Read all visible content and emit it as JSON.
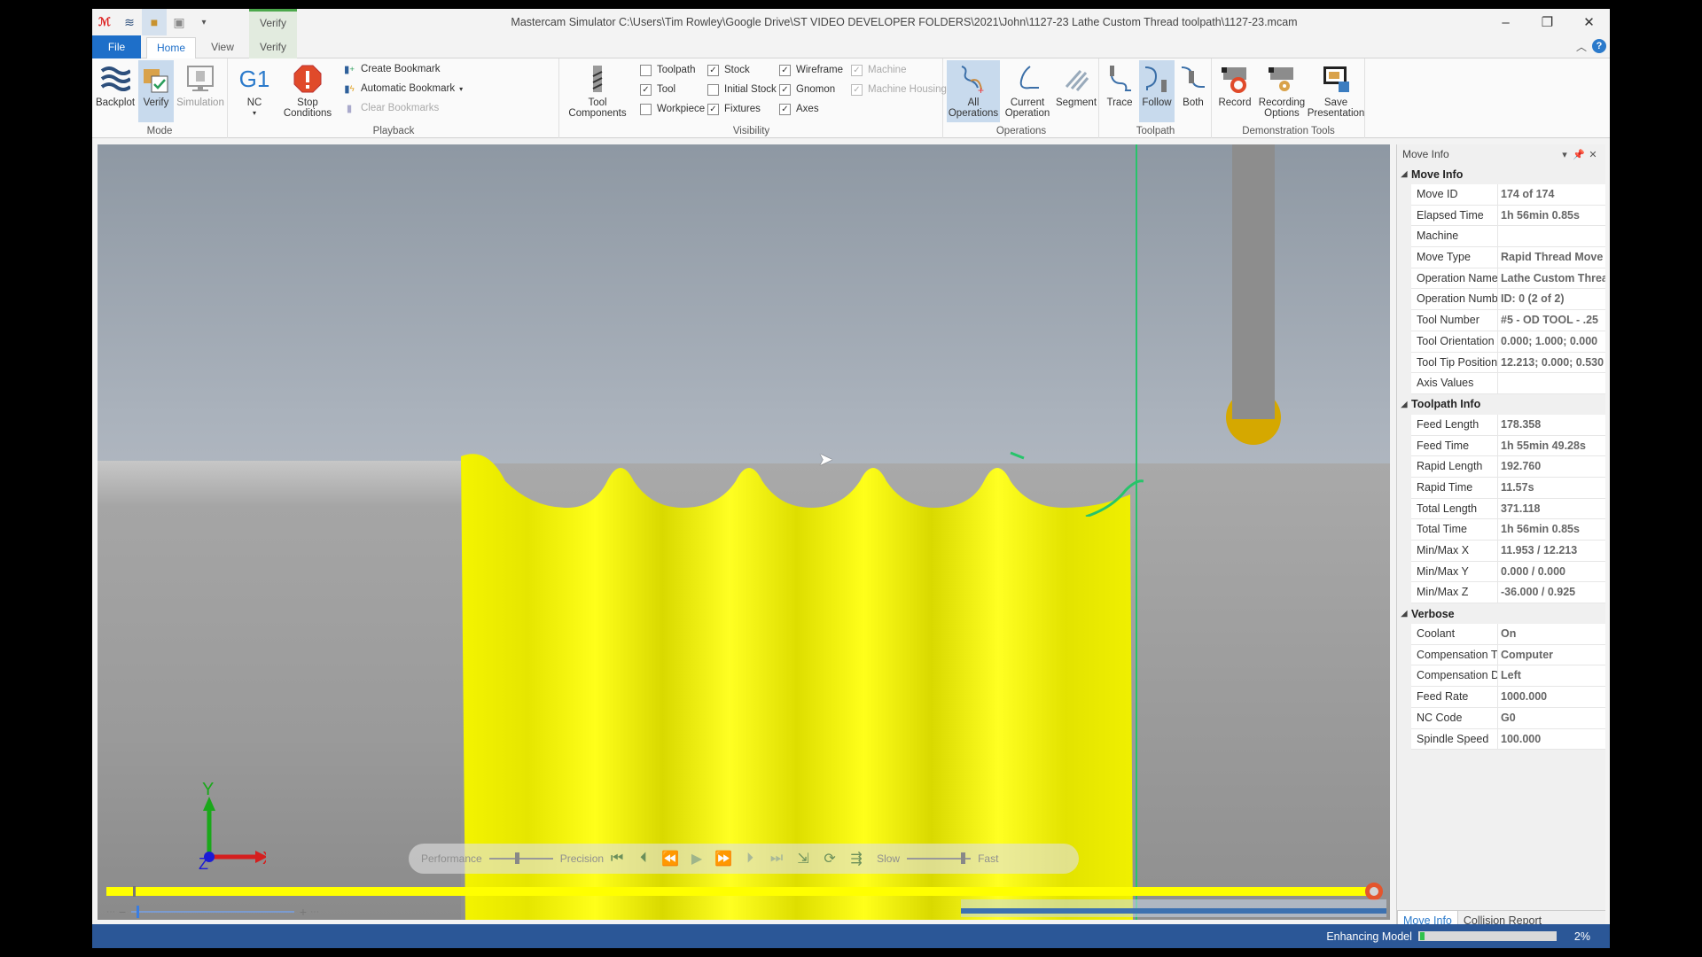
{
  "window": {
    "title": "Mastercam Simulator  C:\\Users\\Tim Rowley\\Google Drive\\ST VIDEO DEVELOPER FOLDERS\\2021\\John\\1127-23 Lathe Custom Thread toolpath\\1127-23.mcam",
    "context_tab": "Verify",
    "controls": {
      "minimize": "–",
      "restore": "❐",
      "close": "✕"
    }
  },
  "tabs": {
    "file": "File",
    "home": "Home",
    "view": "View",
    "verify": "Verify"
  },
  "ribbon": {
    "mode": {
      "label": "Mode",
      "backplot": "Backplot",
      "verify": "Verify",
      "simulation": "Simulation"
    },
    "playback": {
      "label": "Playback",
      "nc_icon": "G1",
      "nc": "NC",
      "stop_conditions": "Stop Conditions",
      "create_bookmark": "Create Bookmark",
      "automatic_bookmark": "Automatic Bookmark",
      "clear_bookmarks": "Clear Bookmarks"
    },
    "visibility": {
      "label": "Visibility",
      "tool_components": "Tool Components",
      "checks": [
        {
          "label": "Toolpath",
          "checked": false,
          "enabled": true
        },
        {
          "label": "Tool",
          "checked": true,
          "enabled": true
        },
        {
          "label": "Workpiece",
          "checked": false,
          "enabled": true
        },
        {
          "label": "Stock",
          "checked": true,
          "enabled": true
        },
        {
          "label": "Initial Stock",
          "checked": false,
          "enabled": true
        },
        {
          "label": "Fixtures",
          "checked": true,
          "enabled": true
        },
        {
          "label": "Wireframe",
          "checked": true,
          "enabled": true
        },
        {
          "label": "Gnomon",
          "checked": true,
          "enabled": true
        },
        {
          "label": "Axes",
          "checked": true,
          "enabled": true
        },
        {
          "label": "Machine",
          "checked": true,
          "enabled": false
        },
        {
          "label": "Machine Housing",
          "checked": true,
          "enabled": false
        }
      ]
    },
    "operations": {
      "label": "Operations",
      "all": "All Operations",
      "current": "Current Operation",
      "segment": "Segment"
    },
    "toolpath": {
      "label": "Toolpath",
      "trace": "Trace",
      "follow": "Follow",
      "both": "Both"
    },
    "demo": {
      "label": "Demonstration Tools",
      "record": "Record",
      "recording_options": "Recording Options",
      "save_presentation": "Save Presentation"
    }
  },
  "viewport": {
    "gnomon": {
      "x": "X",
      "y": "Y",
      "z": "Z"
    },
    "playbar": {
      "performance": "Performance",
      "precision": "Precision",
      "slow": "Slow",
      "fast": "Fast",
      "quality_position": 0.4,
      "speed_position": 0.85
    },
    "timeline_progress": 1.0
  },
  "panel": {
    "title": "Move Info",
    "sections": [
      {
        "name": "Move Info",
        "rows": [
          {
            "k": "Move ID",
            "v": "174 of 174"
          },
          {
            "k": "Elapsed Time",
            "v": "1h 56min 0.85s"
          },
          {
            "k": "Machine",
            "v": ""
          },
          {
            "k": "Move Type",
            "v": "Rapid Thread Move"
          },
          {
            "k": "Operation Name",
            "v": "Lathe Custom Threa"
          },
          {
            "k": "Operation Numb",
            "v": "ID: 0 (2 of 2)"
          },
          {
            "k": "Tool Number",
            "v": "#5 - OD TOOL - .25"
          },
          {
            "k": "Tool Orientation",
            "v": "0.000; 1.000; 0.000"
          },
          {
            "k": "Tool Tip Position",
            "v": "12.213; 0.000; 0.530"
          },
          {
            "k": "Axis Values",
            "v": ""
          }
        ]
      },
      {
        "name": "Toolpath Info",
        "rows": [
          {
            "k": "Feed Length",
            "v": "178.358"
          },
          {
            "k": "Feed Time",
            "v": "1h 55min 49.28s"
          },
          {
            "k": "Rapid Length",
            "v": "192.760"
          },
          {
            "k": "Rapid Time",
            "v": "11.57s"
          },
          {
            "k": "Total Length",
            "v": "371.118"
          },
          {
            "k": "Total Time",
            "v": "1h 56min 0.85s"
          },
          {
            "k": "Min/Max X",
            "v": "11.953 / 12.213"
          },
          {
            "k": "Min/Max Y",
            "v": "0.000 / 0.000"
          },
          {
            "k": "Min/Max Z",
            "v": "-36.000 / 0.925"
          }
        ]
      },
      {
        "name": "Verbose",
        "rows": [
          {
            "k": "Coolant",
            "v": "On"
          },
          {
            "k": "Compensation Ty",
            "v": "Computer"
          },
          {
            "k": "Compensation D",
            "v": "Left"
          },
          {
            "k": "Feed Rate",
            "v": "1000.000"
          },
          {
            "k": "NC Code",
            "v": "G0"
          },
          {
            "k": "Spindle Speed",
            "v": "100.000"
          }
        ]
      }
    ],
    "tabs": [
      "Move Info",
      "Collision Report"
    ]
  },
  "status": {
    "label": "Enhancing Model",
    "percent_text": "2%",
    "progress": 0.02
  },
  "colors": {
    "accent": "#1e6fc9",
    "status_bar": "#2b5797",
    "stock": "#ffff00",
    "toolpath": "#27c46a",
    "tool_tip": "#d5a800",
    "timeline_knob": "#e4552c"
  }
}
